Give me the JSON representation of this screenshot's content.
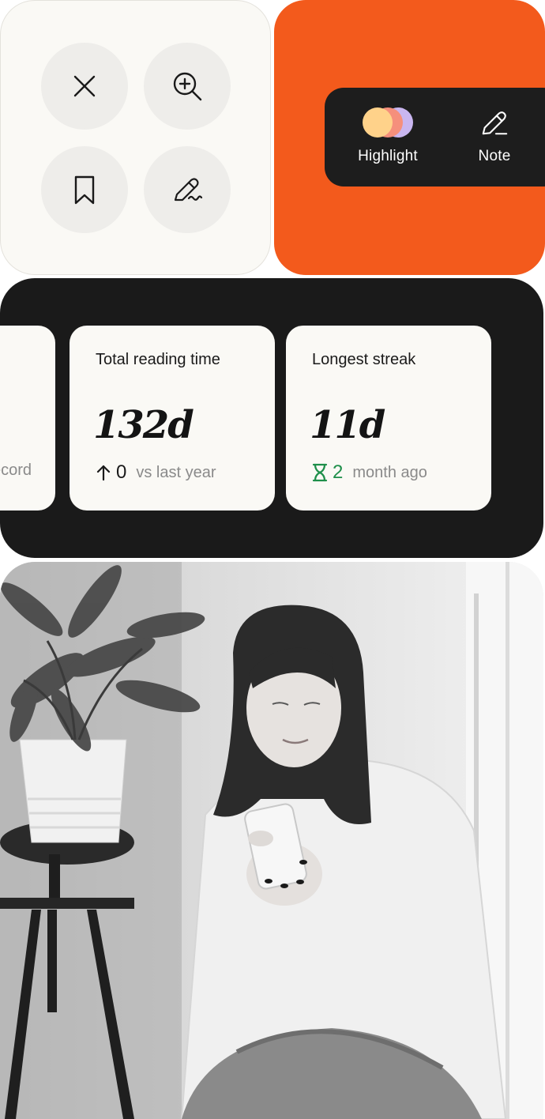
{
  "actions": {
    "buttons": [
      {
        "icon": "close-icon"
      },
      {
        "icon": "zoom-in-icon"
      },
      {
        "icon": "bookmark-icon"
      },
      {
        "icon": "signature-icon"
      }
    ]
  },
  "toolbar": {
    "highlight_label": "Highlight",
    "note_label": "Note",
    "highlight_colors": [
      "#ffd28a",
      "#f58f7c",
      "#c9b6f0"
    ]
  },
  "stats": {
    "record": {
      "caption": "Record"
    },
    "total": {
      "title": "Total reading time",
      "value": "132d",
      "change": "0",
      "caption": "vs last year"
    },
    "streak": {
      "title": "Longest streak",
      "value": "11d",
      "count": "2",
      "caption": "month ago"
    }
  },
  "colors": {
    "accent": "#f35a1c",
    "dark": "#1a1a1a",
    "card": "#faf9f5",
    "streak_green": "#1e8f4a"
  }
}
